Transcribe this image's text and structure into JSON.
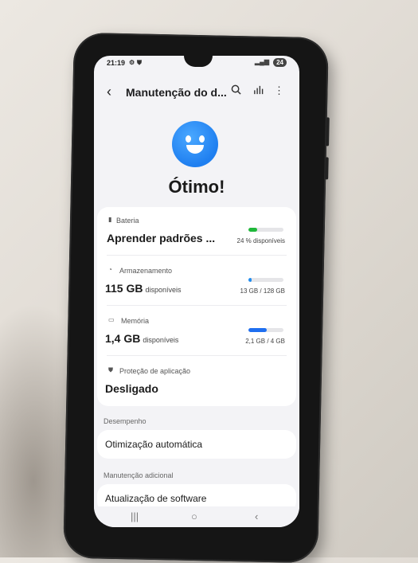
{
  "status": {
    "time": "21:19",
    "battery": "24"
  },
  "appbar": {
    "title": "Manutenção do d..."
  },
  "hero": {
    "headline": "Ótimo!"
  },
  "device_care": {
    "battery": {
      "label": "Bateria",
      "value": "Aprender padrões ...",
      "meta": "24 % disponíveis",
      "level": 0.24,
      "color": "#1fb83a"
    },
    "storage": {
      "label": "Armazenamento",
      "value": "115 GB",
      "unit": "disponíveis",
      "meta": "13 GB / 128 GB",
      "level": 0.1,
      "color": "#1f8cf0"
    },
    "memory": {
      "label": "Memória",
      "value": "1,4 GB",
      "unit": "disponíveis",
      "meta": "2,1 GB / 4 GB",
      "level": 0.52,
      "color": "#1f6ff0"
    },
    "app_protection": {
      "label": "Proteção de aplicação",
      "value": "Desligado"
    }
  },
  "performance": {
    "section": "Desempenho",
    "item": "Otimização automática"
  },
  "additional": {
    "section": "Manutenção adicional",
    "item": "Atualização de software"
  }
}
